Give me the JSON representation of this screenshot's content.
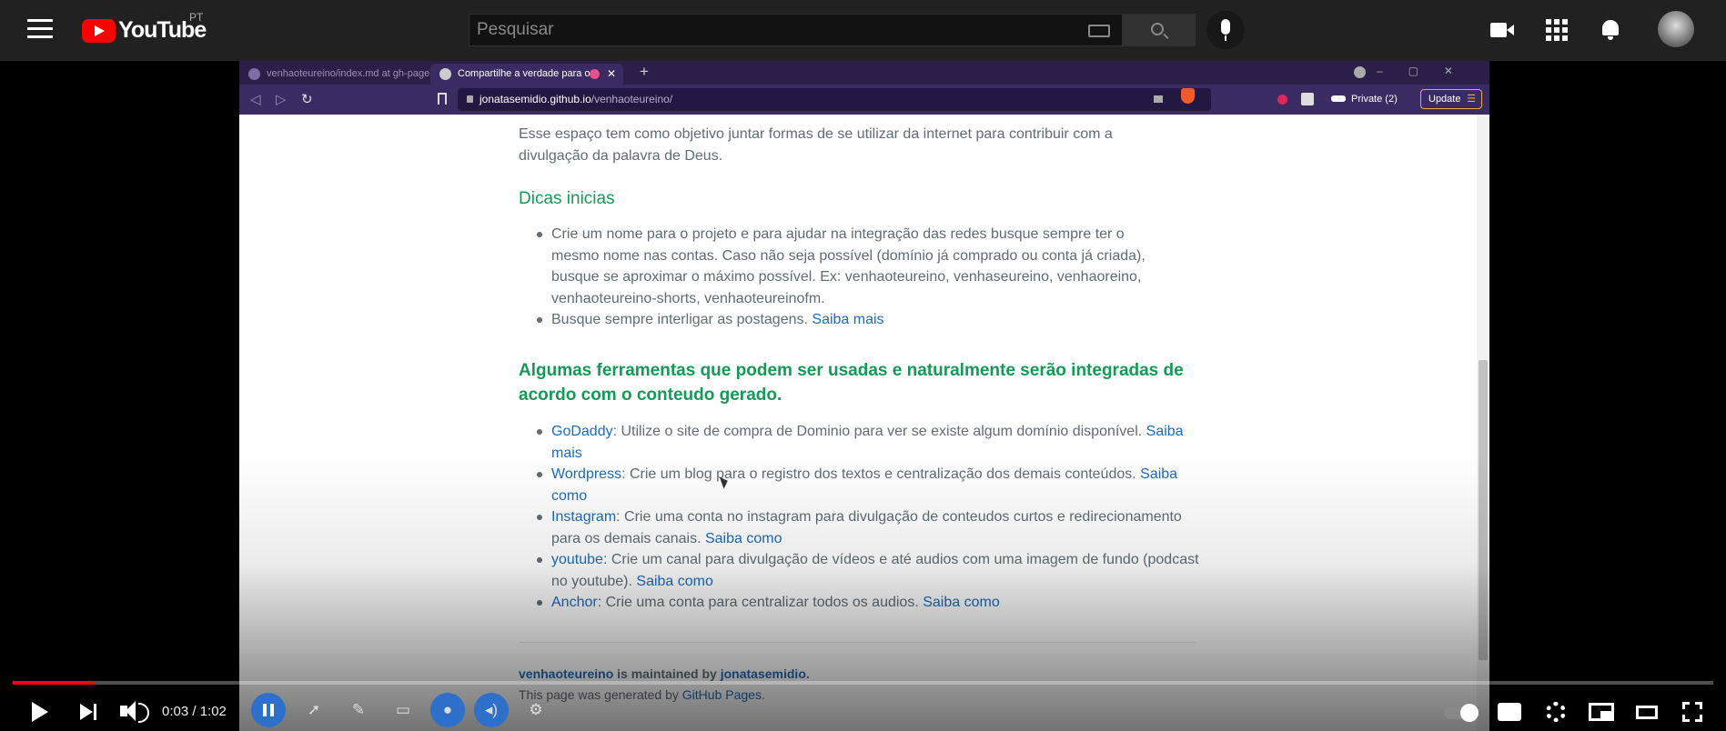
{
  "youtube": {
    "logo_text": "YouTube",
    "country_code": "PT",
    "search_placeholder": "Pesquisar"
  },
  "browser": {
    "tabs": [
      {
        "label": "venhaoteureino/index.md at gh-page",
        "active": false
      },
      {
        "label": "Compartilhe a verdade para o",
        "active": true
      }
    ],
    "url_host": "jonatasemidio.github.io",
    "url_path": "/venhaoteureino/",
    "private_label": "Private (2)",
    "update_label": "Update"
  },
  "page": {
    "intro": "Esse espaço tem como objetivo juntar formas de se utilizar da internet para contribuir com a divulgação da palavra de Deus.",
    "dicas_heading": "Dicas inicias",
    "dicas_items": [
      {
        "text": "Crie um nome para o projeto e para ajudar na integração das redes busque sempre ter o mesmo nome nas contas. Caso não seja possível (domínio já comprado ou conta já criada), busque se aproximar o máximo possível. Ex: venhaoteureino, venhaseureino, venhaoreino, venhaoteureino-shorts, venhaoteureinofm."
      },
      {
        "text": "Busque sempre interligar as postagens. ",
        "link": "Saiba mais"
      }
    ],
    "ferramentas_heading": "Algumas ferramentas que podem ser usadas e naturalmente serão integradas de acordo com o conteudo gerado.",
    "ferramentas_items": [
      {
        "name": "GoDaddy",
        "text": ": Utilize o site de compra de Dominio para ver se existe algum domínio disponível. ",
        "link": "Saiba mais"
      },
      {
        "name": "Wordpress",
        "text": ": Crie um blog para o registro dos textos e centralização dos demais conteúdos. ",
        "link": "Saiba como"
      },
      {
        "name": "Instagram",
        "text": ": Crie uma conta no instagram para divulgação de conteudos curtos e redirecionamento para os demais canais. ",
        "link": "Saiba como"
      },
      {
        "name": "youtube",
        "text": ": Crie um canal para divulgação de vídeos e até audios com uma imagem de fundo (podcast no youtube). ",
        "link": "Saiba como"
      },
      {
        "name": "Anchor",
        "text": ": Crie uma conta para centralizar todos os audios. ",
        "link": "Saiba como"
      }
    ],
    "footer_repo": "venhaoteureino",
    "footer_maintained": " is maintained by ",
    "footer_author": "jonatasemidio",
    "footer_period": ".",
    "footer_generated": "This page was generated by ",
    "footer_ghpages": "GitHub Pages",
    "footer_generated_end": "."
  },
  "player": {
    "time": "0:03 / 1:02",
    "progress_fraction": 0.0484
  },
  "icons": [
    "menu-icon",
    "youtube-logo",
    "keyboard-icon",
    "search-icon",
    "mic-icon",
    "create-video-icon",
    "apps-icon",
    "bell-icon",
    "avatar",
    "play-icon",
    "next-icon",
    "volume-icon",
    "pause-icon",
    "pointer-icon",
    "pen-icon",
    "camera-icon",
    "microphone-icon",
    "speaker-icon",
    "gear-icon",
    "autoplay-toggle",
    "captions-icon",
    "miniplayer-icon",
    "theater-icon",
    "fullscreen-icon"
  ],
  "colors": {
    "youtube_red": "#ff0000",
    "heading_green": "#159957",
    "link_blue": "#1e6bb8",
    "browser_purple": "#3a2c63"
  }
}
